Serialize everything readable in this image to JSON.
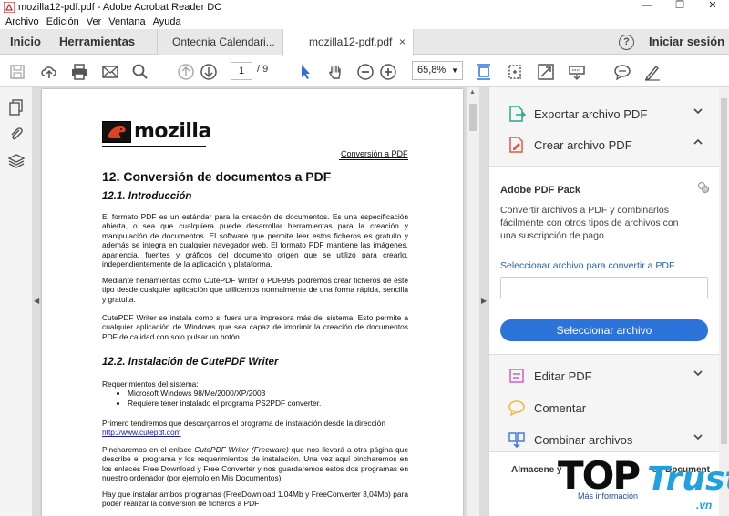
{
  "window": {
    "title": "mozilla12-pdf.pdf - Adobe Acrobat Reader DC",
    "controls": [
      "—",
      "❐",
      "✕"
    ]
  },
  "menu": [
    "Archivo",
    "Edición",
    "Ver",
    "Ventana",
    "Ayuda"
  ],
  "tabs": {
    "home": "Inicio",
    "tools": "Herramientas",
    "docs": [
      {
        "label": "Ontecnia Calendari...",
        "active": false
      },
      {
        "label": "mozilla12-pdf.pdf",
        "active": true,
        "close": "×"
      }
    ],
    "help": "?",
    "signin": "Iniciar sesión"
  },
  "toolbar": {
    "page_current": "1",
    "page_total": "/ 9",
    "zoom": "65,8%",
    "zoom_arrow": "▼",
    "icons": [
      "save-icon",
      "upload-icon",
      "print-icon",
      "email-icon",
      "search-icon",
      "page-up-icon",
      "page-down-icon",
      "select-icon",
      "hand-icon",
      "zoom-out-icon",
      "zoom-in-icon",
      "fit-width-icon",
      "rotate-icon",
      "fullscreen-icon",
      "keyboard-icon",
      "comment-icon",
      "sign-icon"
    ]
  },
  "document": {
    "logo_text": "mozilla",
    "header_link": "Conversión a PDF",
    "h1": "12. Conversión de documentos a PDF",
    "s1_title": "12.1. Introducción",
    "p1": "El formato PDF es un estándar para la creación de documentos. Es una especificación abierta, o sea que cualquiera puede desarrollar herramientas para la creación y manipulación de documentos. El software que permite leer estos ficheros es gratuito y además se integra en cualquier navegador web. El formato PDF mantiene las imágenes, apariencia, fuentes y gráficos del documento origen que se utilizó para crearlo, independientemente de la aplicación y plataforma.",
    "p2": "Mediante herramientas como CutePDF Writer o PDF995 podremos crear ficheros de este tipo desde cualquier aplicación que utilicemos normalmente de una forma rápida, sencilla y gratuita.",
    "p3": "CutePDF Writer se instala como si fuera una impresora más del sistema. Esto permite a cualquier aplicación de Windows que sea capaz de imprimir la creación de documentos PDF de calidad con solo pulsar un botón.",
    "s2_title": "12.2. Instalación de CutePDF Writer",
    "req_title": "Requerimientos del sistema:",
    "req_items": [
      "Microsoft Windows 98/Me/2000/XP/2003",
      "Requiere tener instalado el programa PS2PDF converter."
    ],
    "p4": "Primero tendremos que descargarnos el programa de instalación desde la dirección",
    "p4_link": "http://www.cutepdf.com",
    "p5_a": "Pincharemos en el enlace ",
    "p5_em": "CutePDF Writer (Freeware)",
    "p5_b": " que nos llevará a otra página que describe el programa y los requerimientos de instalación. Una vez aquí pincharemos en los enlaces Free Download y Free Converter y nos guardaremos estos dos programas en nuestro ordenador (por ejemplo en Mis Documentos).",
    "p6": "Hay que instalar ambos programas (FreeDownload 1.04Mb y FreeConverter 3,04Mb) para poder realizar la conversión de ficheros a PDF"
  },
  "right_pane": {
    "items_top": [
      {
        "label": "Exportar archivo PDF",
        "chev": "down"
      },
      {
        "label": "Crear archivo PDF",
        "chev": "up"
      }
    ],
    "panel": {
      "name": "Adobe PDF Pack",
      "desc": "Convertir archivos a PDF y combinarlos fácilmente con otros tipos de archivos con una suscripción de pago",
      "link": "Seleccionar archivo para convertir a PDF",
      "button": "Seleccionar archivo"
    },
    "items_bottom": [
      {
        "label": "Editar PDF",
        "chev": "down"
      },
      {
        "label": "Comentar",
        "chev": ""
      },
      {
        "label": "Combinar archivos",
        "chev": "down"
      }
    ],
    "footer_left": "Almacene y",
    "footer_right": "en Document"
  },
  "watermark": {
    "top": "TOP",
    "trust": "Trust",
    "more": "Más información",
    "vn": ".vn"
  },
  "colors": {
    "accent": "#2d74da",
    "export_icon": "#2aa88a",
    "create_icon": "#e05a47",
    "edit_icon": "#d35ec5",
    "comment_icon": "#f2b83a",
    "combine_icon": "#3a74d8",
    "watermark_blue": "#1ea2e0"
  }
}
